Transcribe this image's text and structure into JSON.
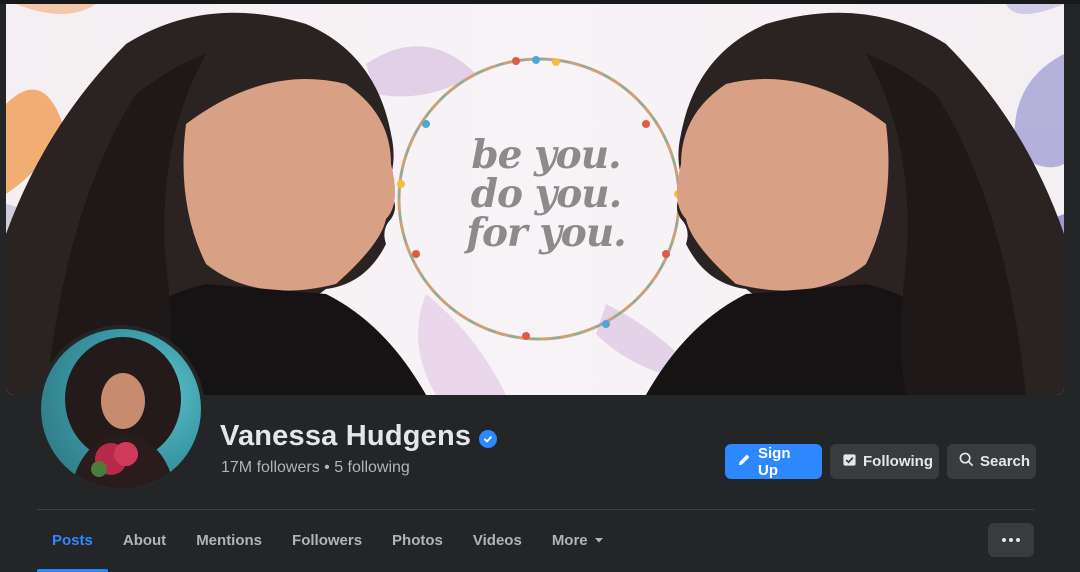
{
  "cover": {
    "quote_lines": [
      "be you.",
      "do you.",
      "for you."
    ]
  },
  "profile": {
    "name": "Vanessa Hudgens",
    "stats": "17M followers • 5 following",
    "verified_icon": "verified-badge-icon"
  },
  "actions": {
    "sign_up": "Sign Up",
    "following": "Following",
    "search": "Search"
  },
  "tabs": [
    {
      "label": "Posts",
      "active": true
    },
    {
      "label": "About"
    },
    {
      "label": "Mentions"
    },
    {
      "label": "Followers"
    },
    {
      "label": "Photos"
    },
    {
      "label": "Videos"
    },
    {
      "label": "More"
    }
  ],
  "colors": {
    "accent": "#2d88ff",
    "background": "#242526",
    "button_secondary": "#3a3b3c",
    "text_primary": "#e4e6eb",
    "text_secondary": "#b0b3b8"
  }
}
